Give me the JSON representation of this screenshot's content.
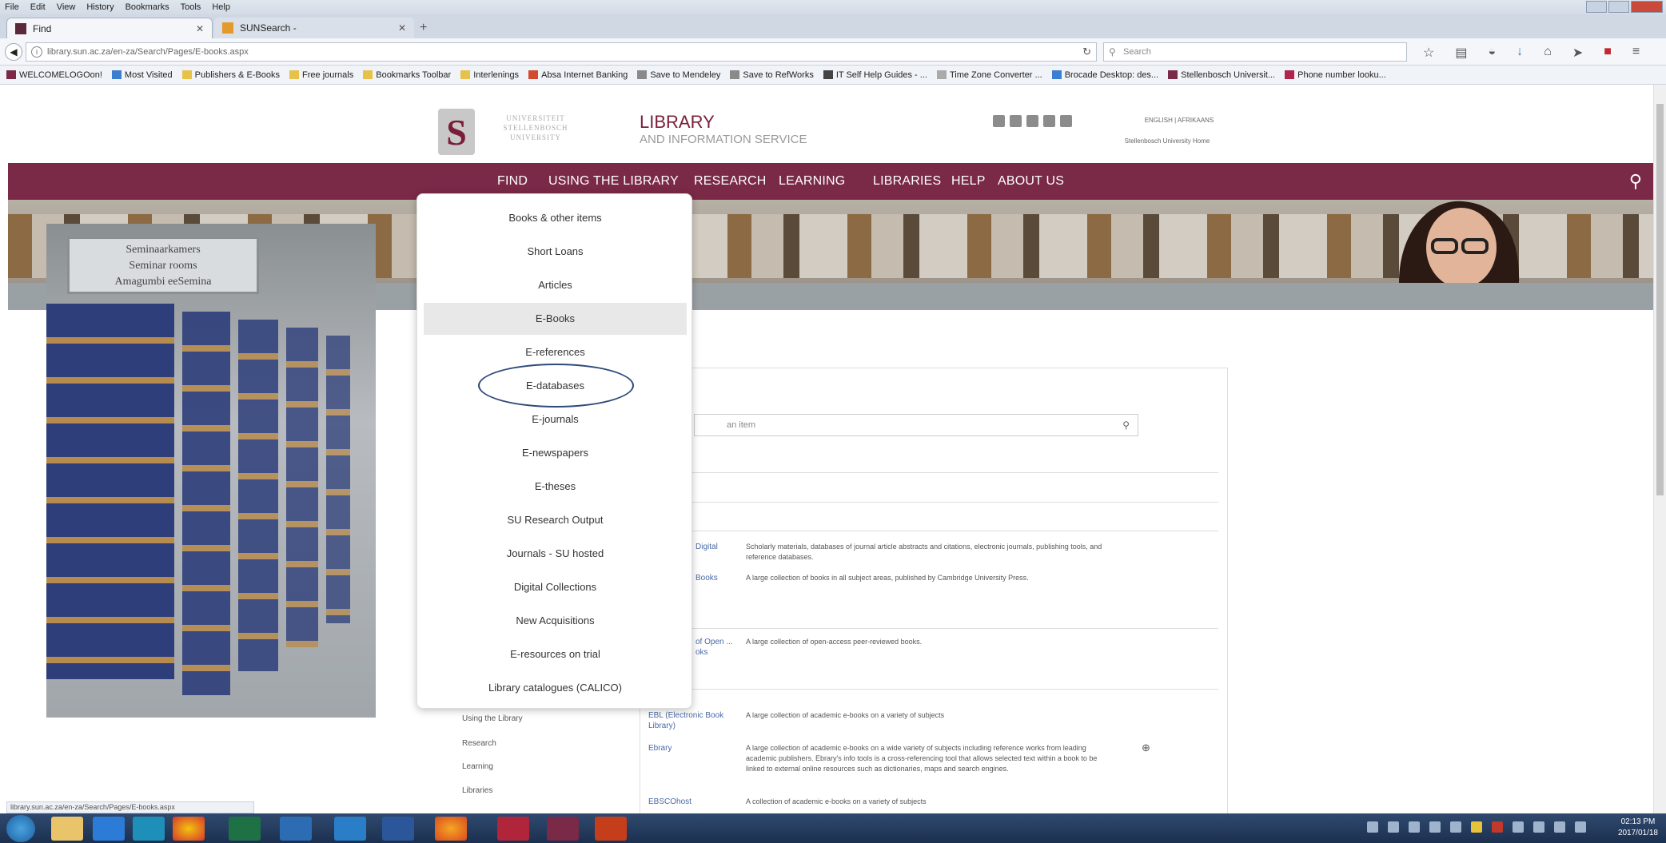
{
  "browser": {
    "menu": [
      "File",
      "Edit",
      "View",
      "History",
      "Bookmarks",
      "Tools",
      "Help"
    ],
    "tabs": [
      {
        "label": "Find"
      },
      {
        "label": "SUNSearch -"
      }
    ],
    "url": "library.sun.ac.za/en-za/Search/Pages/E-books.aspx",
    "search_placeholder": "Search",
    "bookmarks": [
      "WELCOMELOGOon!",
      "Most Visited",
      "Publishers & E-Books",
      "Free journals",
      "Bookmarks Toolbar",
      "Interlenings",
      "Absa Internet Banking",
      "Save to Mendeley",
      "Save to RefWorks",
      "IT Self Help Guides - ...",
      "Time Zone Converter ...",
      "Brocade Desktop: des...",
      "Stellenbosch Universit...",
      "Phone number looku..."
    ],
    "status_url": "library.sun.ac.za/en-za/Search/Pages/E-books.aspx"
  },
  "header": {
    "university_name": "UNIVERSITEIT STELLENBOSCH UNIVERSITY",
    "title": "LIBRARY",
    "subtitle": "AND INFORMATION SERVICE",
    "language": "ENGLISH | AFRIKAANS",
    "home_link": "Stellenbosch University Home"
  },
  "nav": {
    "items": [
      "FIND",
      "USING THE LIBRARY",
      "RESEARCH",
      "LEARNING",
      "LIBRARIES",
      "HELP",
      "ABOUT US"
    ]
  },
  "photo_sign": {
    "line1": "Seminaarkamers",
    "line2": "Seminar rooms",
    "line3": "Amagumbi eeSemina"
  },
  "dropdown": {
    "items": [
      "Books & other items",
      "Short Loans",
      "Articles",
      "E-Books",
      "E-references",
      "E-databases",
      "E-journals",
      "E-newspapers",
      "E-theses",
      "SU Research Output",
      "Journals - SU hosted",
      "Digital Collections",
      "New Acquisitions",
      "E-resources on trial",
      "Library catalogues (CALICO)"
    ]
  },
  "content": {
    "search_placeholder": "an item",
    "side_nav": [
      "Using the Library",
      "Research",
      "Learning",
      "Libraries"
    ],
    "rows": [
      {
        "link": "Digital",
        "desc": "Scholarly materials, databases of journal article abstracts and citations, electronic journals, publishing tools, and reference databases."
      },
      {
        "link": "Books",
        "desc": "A large collection of books in all subject areas, published by Cambridge University Press."
      },
      {
        "link": "of Open ... oks",
        "desc": "A large collection of open-access peer-reviewed books."
      },
      {
        "link": "EBL (Electronic Book Library)",
        "desc": "A large collection of academic e-books on a variety of subjects"
      },
      {
        "link": "Ebrary",
        "desc": "A large collection of academic e-books on a wide variety of subjects including reference works from leading academic publishers. Ebrary's info tools is a cross-referencing tool that allows selected text within a book to be linked to external online resources such as dictionaries, maps and search engines."
      },
      {
        "link": "EBSCOhost",
        "desc": "A collection of academic e-books on a variety of subjects"
      }
    ]
  },
  "clock": {
    "time": "02:13 PM",
    "date": "2017/01/18"
  }
}
